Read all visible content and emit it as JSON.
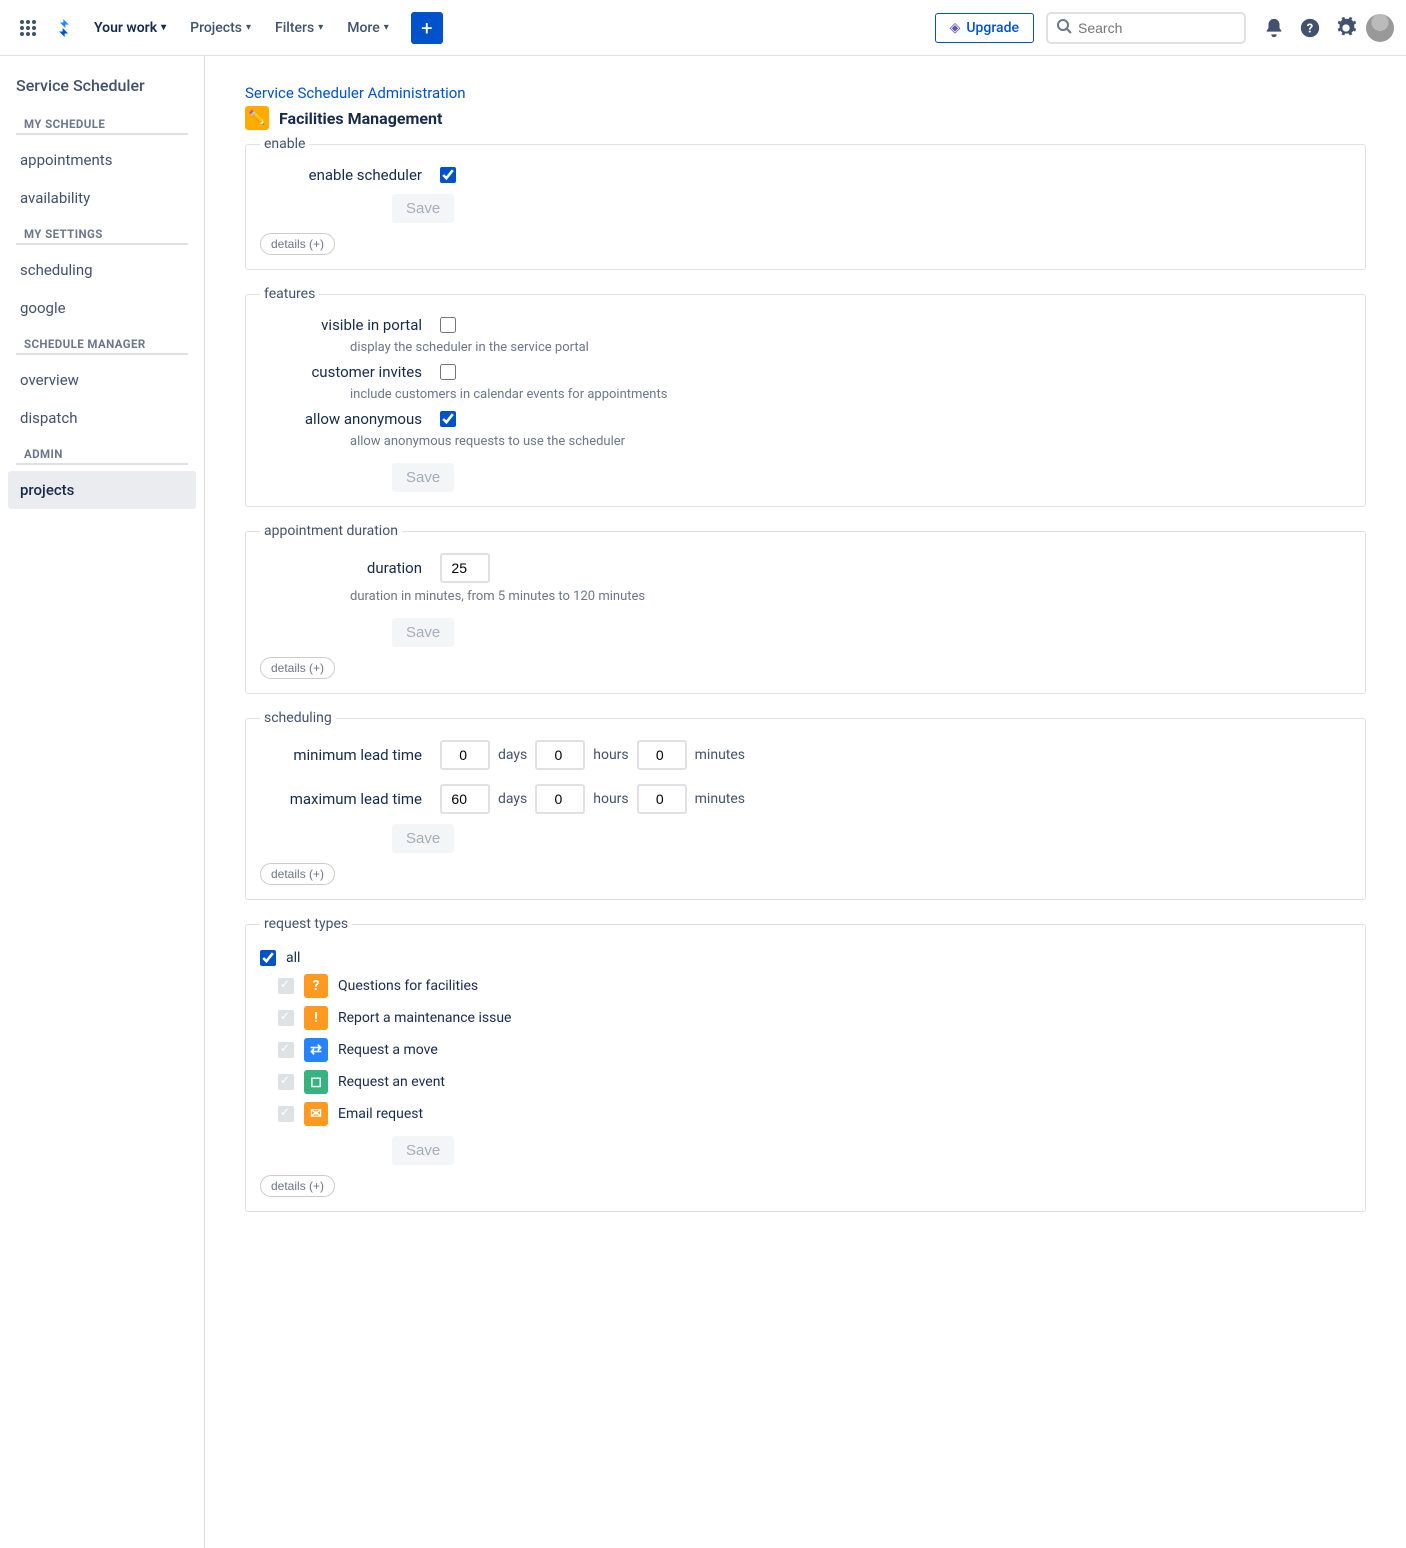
{
  "topnav": {
    "your_work": "Your work",
    "projects": "Projects",
    "filters": "Filters",
    "more": "More",
    "upgrade": "Upgrade",
    "search_placeholder": "Search"
  },
  "sidebar": {
    "title": "Service Scheduler",
    "sections": [
      {
        "header": "MY SCHEDULE",
        "items": [
          "appointments",
          "availability"
        ]
      },
      {
        "header": "MY SETTINGS",
        "items": [
          "scheduling",
          "google"
        ]
      },
      {
        "header": "SCHEDULE MANAGER",
        "items": [
          "overview",
          "dispatch"
        ]
      },
      {
        "header": "ADMIN",
        "items": [
          "projects"
        ]
      }
    ],
    "active": "projects"
  },
  "breadcrumb": "Service Scheduler Administration",
  "project_name": "Facilities Management",
  "enable": {
    "legend": "enable",
    "label": "enable scheduler",
    "checked": true,
    "save": "Save",
    "details": "details (+)"
  },
  "features": {
    "legend": "features",
    "rows": [
      {
        "label": "visible in portal",
        "checked": false,
        "desc": "display the scheduler in the service portal"
      },
      {
        "label": "customer invites",
        "checked": false,
        "desc": "include customers in calendar events for appointments"
      },
      {
        "label": "allow anonymous",
        "checked": true,
        "desc": "allow anonymous requests to use the scheduler"
      }
    ],
    "save": "Save"
  },
  "duration": {
    "legend": "appointment duration",
    "label": "duration",
    "value": 25,
    "desc": "duration in minutes, from 5 minutes to 120 minutes",
    "save": "Save",
    "details": "details (+)"
  },
  "scheduling": {
    "legend": "scheduling",
    "min_label": "minimum lead time",
    "max_label": "maximum lead time",
    "min": {
      "days": 0,
      "hours": 0,
      "minutes": 0
    },
    "max": {
      "days": 60,
      "hours": 0,
      "minutes": 0
    },
    "units": {
      "days": "days",
      "hours": "hours",
      "minutes": "minutes"
    },
    "save": "Save",
    "details": "details (+)"
  },
  "request_types": {
    "legend": "request types",
    "all_label": "all",
    "all_checked": true,
    "items": [
      {
        "label": "Questions for facilities",
        "color": "#FF991F",
        "glyph": "?"
      },
      {
        "label": "Report a maintenance issue",
        "color": "#FF991F",
        "glyph": "!"
      },
      {
        "label": "Request a move",
        "color": "#2684FF",
        "glyph": "⇄"
      },
      {
        "label": "Request an event",
        "color": "#36B37E",
        "glyph": "◻"
      },
      {
        "label": "Email request",
        "color": "#FF991F",
        "glyph": "✉"
      }
    ],
    "save": "Save",
    "details": "details (+)"
  }
}
